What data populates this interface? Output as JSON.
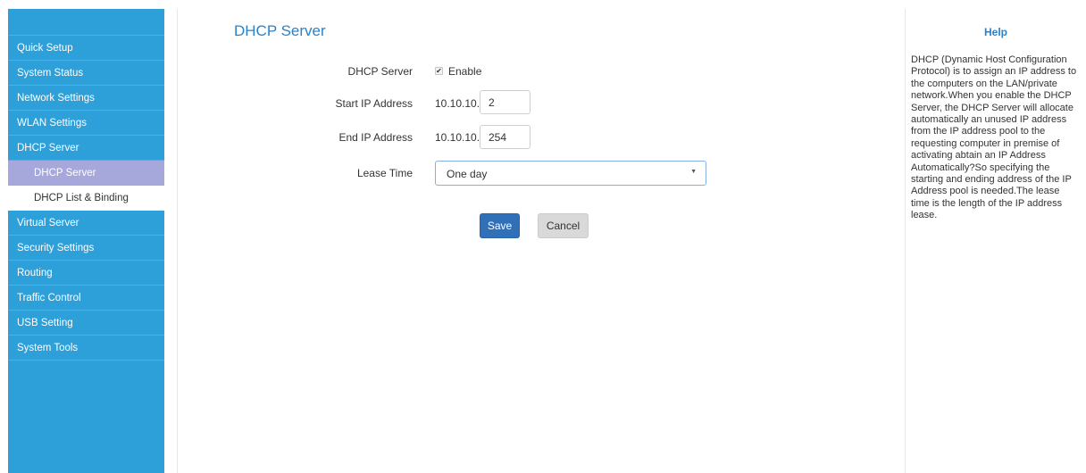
{
  "sidebar": {
    "items_before": [
      {
        "label": "Quick Setup",
        "name": "sidebar-item-quick-setup"
      },
      {
        "label": "System Status",
        "name": "sidebar-item-system-status"
      },
      {
        "label": "Network Settings",
        "name": "sidebar-item-network-settings"
      },
      {
        "label": "WLAN Settings",
        "name": "sidebar-item-wlan-settings"
      },
      {
        "label": "DHCP Server",
        "name": "sidebar-item-dhcp-server"
      }
    ],
    "subitems": [
      {
        "label": "DHCP Server",
        "active": true
      },
      {
        "label": "DHCP List & Binding",
        "active": false
      }
    ],
    "items_after": [
      {
        "label": "Virtual Server",
        "name": "sidebar-item-virtual-server"
      },
      {
        "label": "Security Settings",
        "name": "sidebar-item-security-settings"
      },
      {
        "label": "Routing",
        "name": "sidebar-item-routing"
      },
      {
        "label": "Traffic Control",
        "name": "sidebar-item-traffic-control"
      },
      {
        "label": "USB Setting",
        "name": "sidebar-item-usb-setting"
      },
      {
        "label": "System Tools",
        "name": "sidebar-item-system-tools"
      }
    ]
  },
  "main": {
    "title": "DHCP Server",
    "dhcp_label": "DHCP Server",
    "enable_label": "Enable",
    "enable_checked": true,
    "check_glyph": "✔",
    "start_ip_label": "Start IP Address",
    "start_ip_prefix": "10.10.10.",
    "start_ip_value": "2",
    "end_ip_label": "End IP Address",
    "end_ip_prefix": "10.10.10.",
    "end_ip_value": "254",
    "lease_label": "Lease Time",
    "lease_value": "One day",
    "save_label": "Save",
    "cancel_label": "Cancel"
  },
  "help": {
    "title": "Help",
    "text": "DHCP (Dynamic Host Configuration Protocol) is to assign an IP address to the computers on the LAN/private network.When you enable the DHCP Server, the DHCP Server will allocate automatically an unused IP address from the IP address pool to the requesting computer in premise of activating abtain an IP Address Automatically?So specifying the starting and ending address of the IP Address pool is needed.The lease time is the length of the IP address lease."
  },
  "colors": {
    "sidebar_bg": "#2d9fd9",
    "submenu_active_bg": "#a6a8db",
    "accent": "#2b82c9",
    "save_button": "#2f70b8",
    "cancel_button": "#d9d9d9"
  }
}
